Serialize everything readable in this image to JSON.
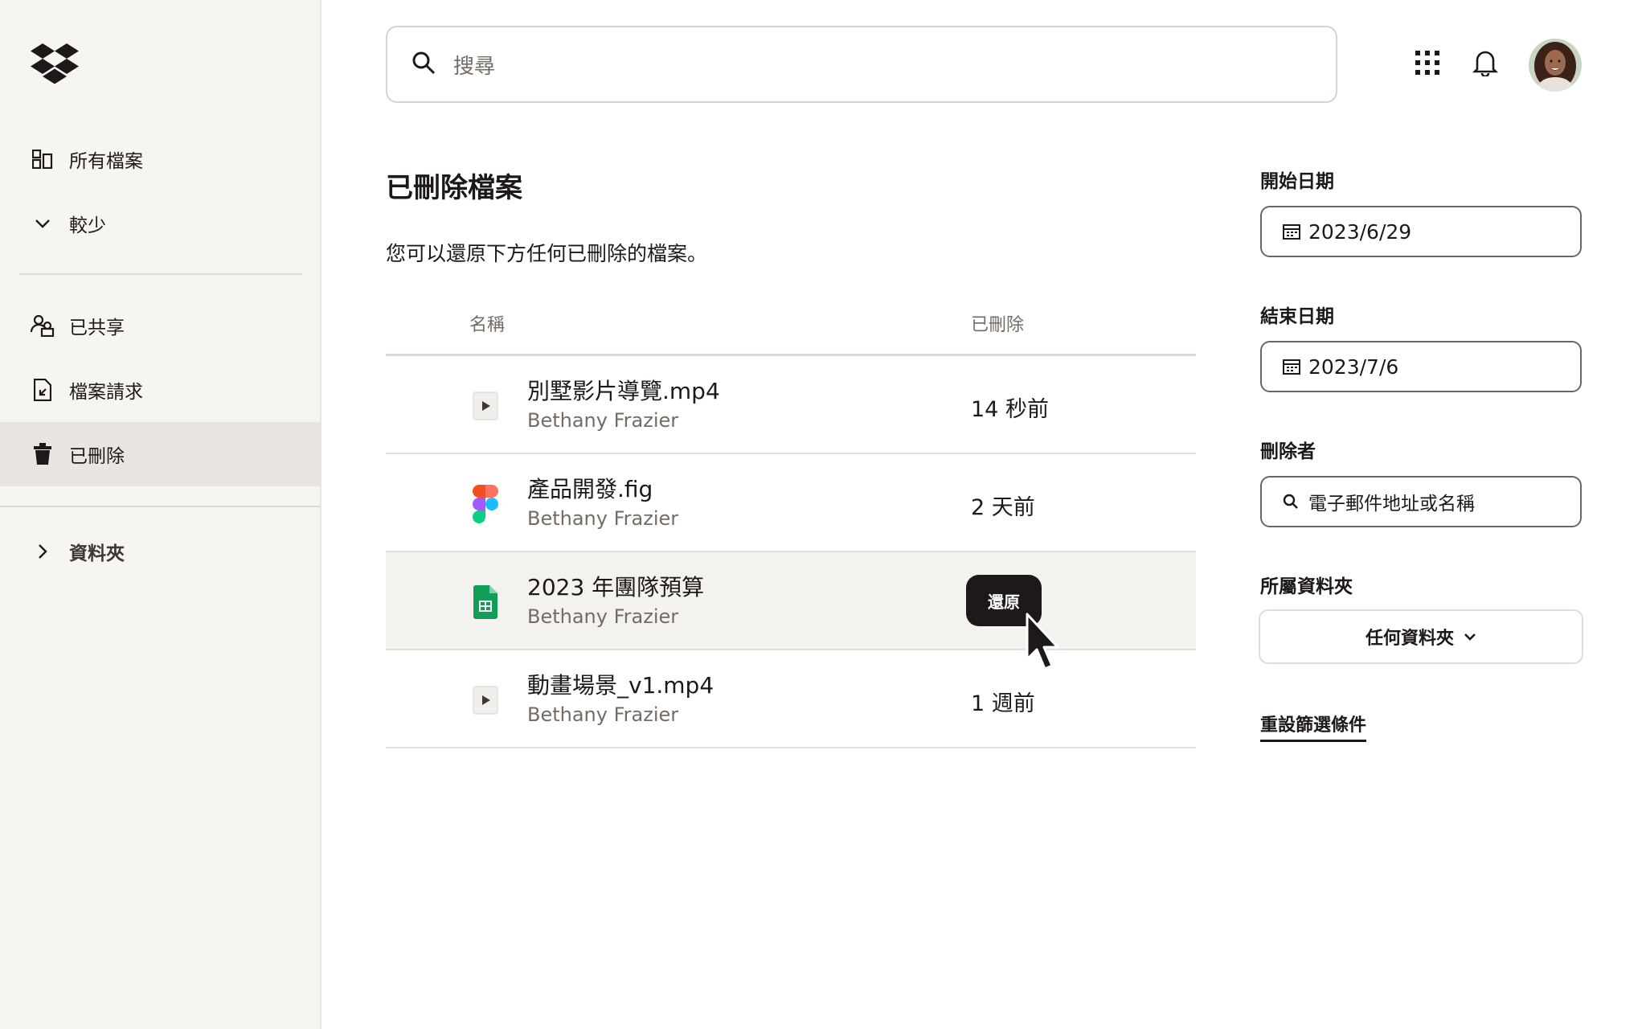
{
  "sidebar": {
    "items": [
      {
        "label": "所有檔案",
        "icon": "all-files-icon"
      },
      {
        "label": "較少",
        "icon": "chevron-down-icon"
      },
      {
        "label": "已共享",
        "icon": "shared-icon"
      },
      {
        "label": "檔案請求",
        "icon": "file-request-icon"
      },
      {
        "label": "已刪除",
        "icon": "trash-icon",
        "active": true
      },
      {
        "label": "資料夾",
        "icon": "chevron-right-icon"
      }
    ]
  },
  "search": {
    "placeholder": "搜尋"
  },
  "main": {
    "title": "已刪除檔案",
    "subtitle": "您可以還原下方任何已刪除的檔案。",
    "columns": {
      "name": "名稱",
      "deleted": "已刪除"
    },
    "files": [
      {
        "name": "別墅影片導覽.mp4",
        "owner": "Bethany Frazier",
        "deleted": "14 秒前",
        "type": "video"
      },
      {
        "name": "產品開發.fig",
        "owner": "Bethany Frazier",
        "deleted": "2 天前",
        "type": "figma"
      },
      {
        "name": "2023 年團隊預算",
        "owner": "Bethany Frazier",
        "deleted": "",
        "type": "sheet",
        "action": "還原"
      },
      {
        "name": "動畫場景_v1.mp4",
        "owner": "Bethany Frazier",
        "deleted": "1 週前",
        "type": "video"
      }
    ]
  },
  "filters": {
    "start_label": "開始日期",
    "start_value": "2023/6/29",
    "end_label": "結束日期",
    "end_value": "2023/7/6",
    "deleted_by_label": "刪除者",
    "deleted_by_placeholder": "電子郵件地址或名稱",
    "folder_label": "所屬資料夾",
    "folder_value": "任何資料夾",
    "reset_label": "重設篩選條件"
  },
  "colors": {
    "accent": "#1e1919",
    "sidebar_bg": "#f7f5f2",
    "figma_red": "#f24e1e",
    "sheet_green": "#0f9d58"
  }
}
